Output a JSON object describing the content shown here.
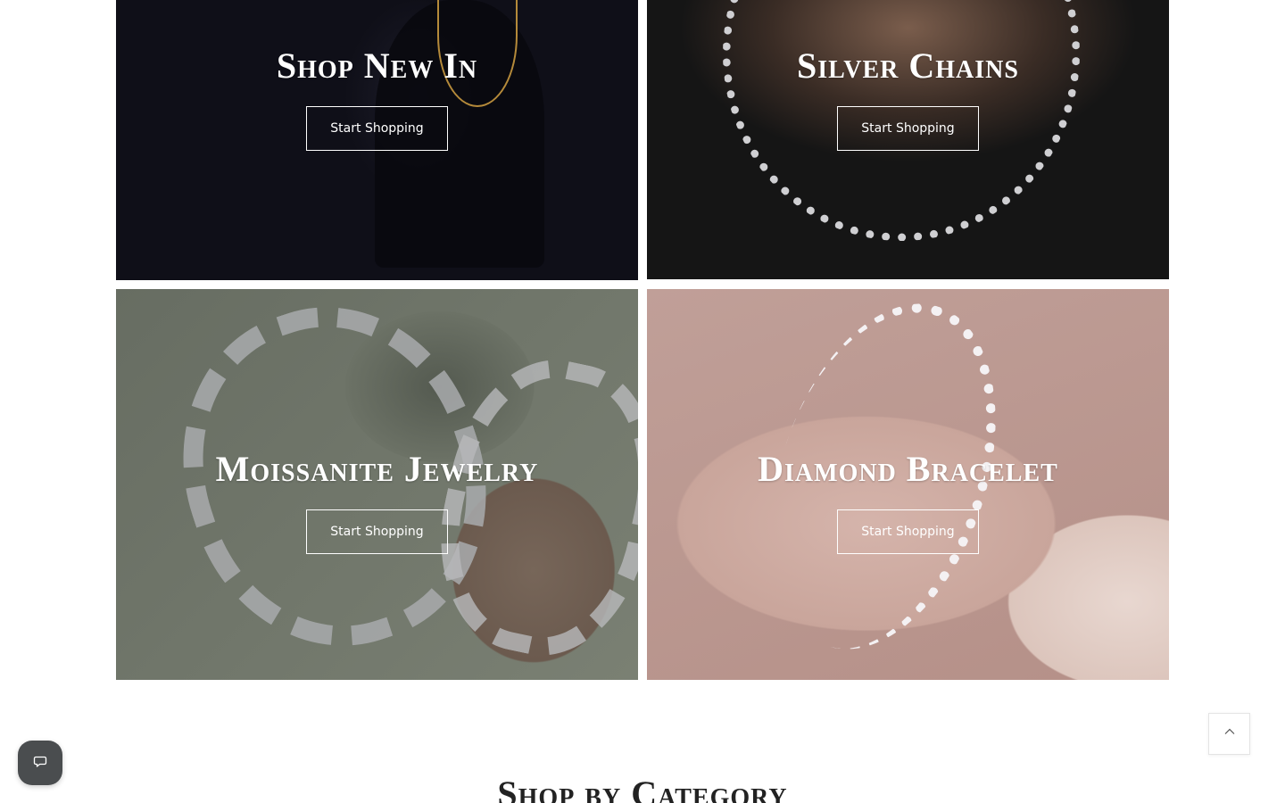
{
  "tiles": [
    {
      "title": "Shop New In",
      "button_label": "Start Shopping"
    },
    {
      "title": "Silver Chains",
      "button_label": "Start Shopping"
    },
    {
      "title": "Moissanite Jewelry",
      "button_label": "Start Shopping"
    },
    {
      "title": "Diamond Bracelet",
      "button_label": "Start Shopping"
    }
  ],
  "section": {
    "title": "Shop by Category"
  },
  "widgets": {
    "chat_icon": "chat-bubble-icon",
    "top_icon": "chevron-up-icon"
  }
}
